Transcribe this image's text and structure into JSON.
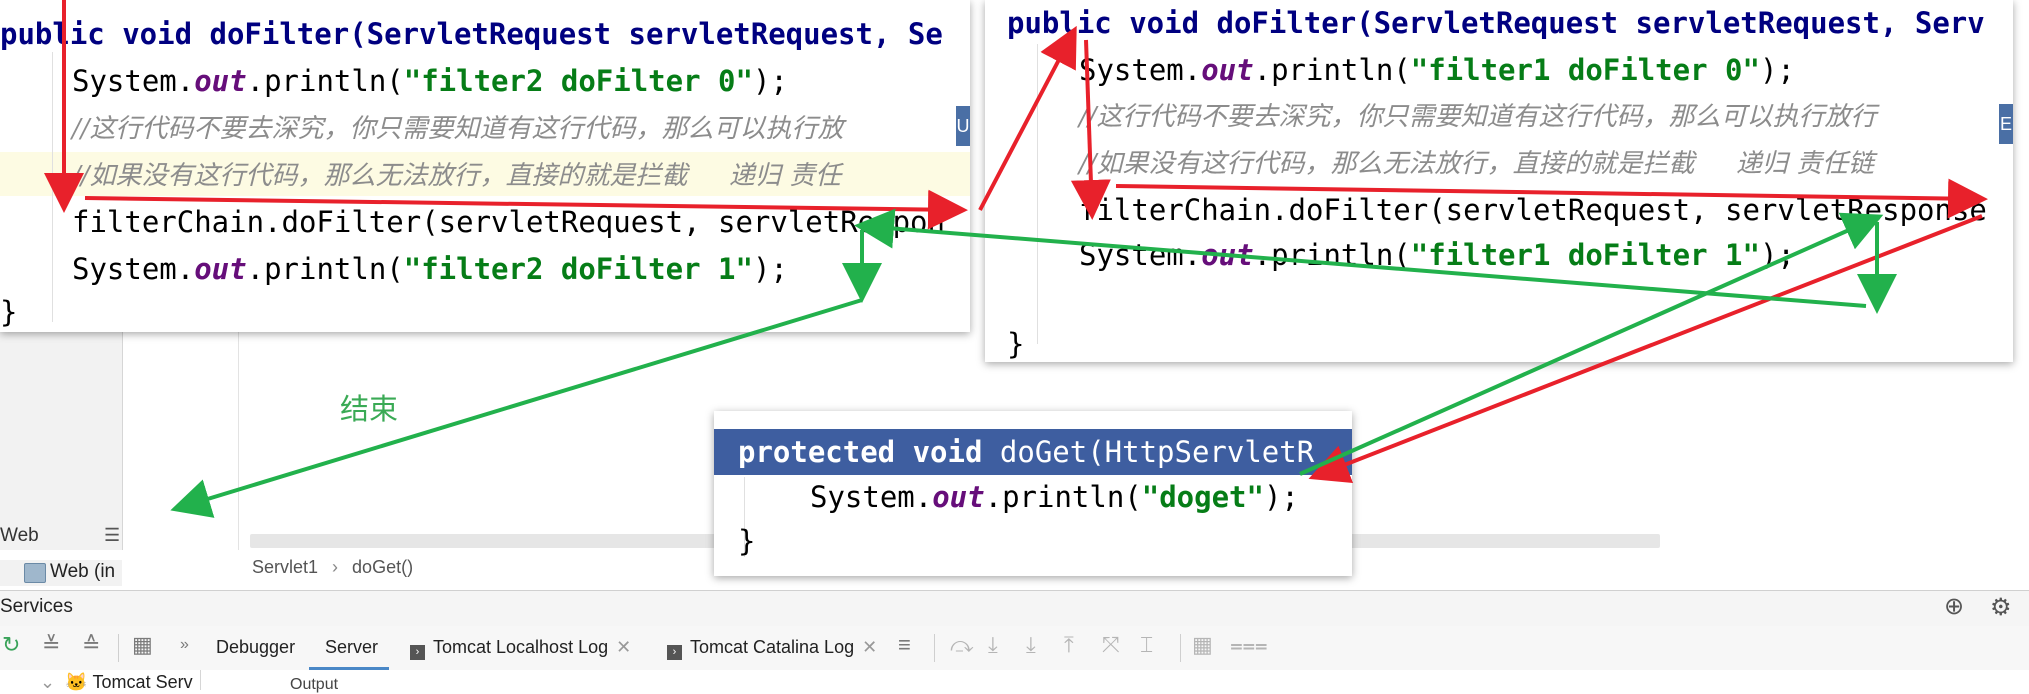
{
  "ide": {
    "web_panel_label": "Web",
    "web_item_label": "Web (in",
    "breadcrumb": [
      "Servlet1",
      "doGet()"
    ]
  },
  "services": {
    "title": "Services",
    "tabs": [
      {
        "label": "Debugger"
      },
      {
        "label": "Server"
      },
      {
        "label": "Tomcat Localhost Log"
      },
      {
        "label": "Tomcat Catalina Log"
      }
    ],
    "tree_node": "Tomcat Serv",
    "output_label": "Output"
  },
  "annotation": {
    "end_label": "结束"
  },
  "code_left": {
    "line1": "public void doFilter(ServletRequest servletRequest, Se",
    "line2_pre": "System.",
    "line2_out": "out",
    "line2_mid": ".println(",
    "line2_str": "\"filter2 doFilter 0\"",
    "line2_post": ");",
    "line3": "//这行代码不要去深究，你只需要知道有这行代码，那么可以执行放",
    "line4": "//如果没有这行代码，那么无法放行，直接的就是拦截     递归 责任",
    "line5": "filterChain.doFilter(servletRequest, servletRespon",
    "line6_str": "\"filter2 doFilter 1\"",
    "line7": "}"
  },
  "code_right": {
    "line1": "public void doFilter(ServletRequest servletRequest, Serv",
    "line2_str": "\"filter1 doFilter 0\"",
    "line3": "//这行代码不要去深究，你只需要知道有这行代码，那么可以执行放行",
    "line4": "//如果没有这行代码，那么无法放行，直接的就是拦截     递归 责任链",
    "line5": "filterChain.doFilter(servletRequest, servletResponse",
    "line6_str": "\"filter1 doFilter 1\"",
    "line7": "}"
  },
  "code_bottom": {
    "line1_kw": "protected void",
    "line1_rest": " doGet(HttpServletR",
    "line2_str": "\"doget\"",
    "line3": "}"
  },
  "colors": {
    "arrow_red": "#e8212b",
    "arrow_green": "#22b14c",
    "keyword": "#000080",
    "string": "#067d17",
    "static_field": "#660e7a",
    "comment": "#8c8c8c"
  }
}
